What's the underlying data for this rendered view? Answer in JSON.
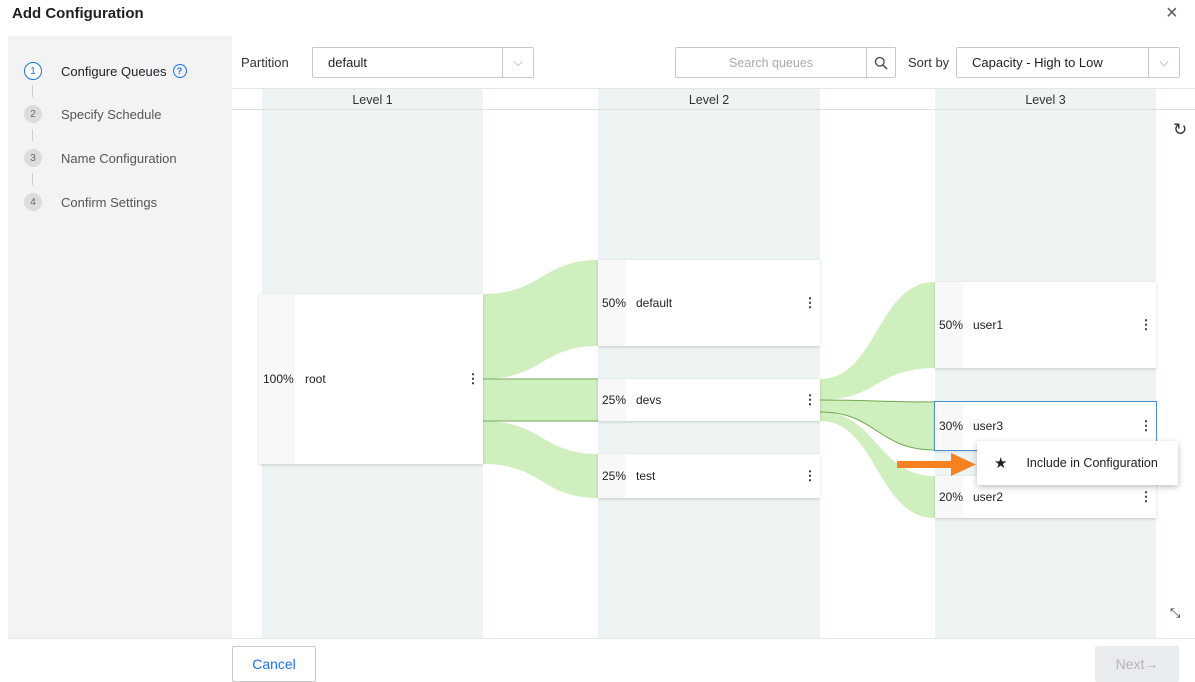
{
  "dialog": {
    "title": "Add Configuration",
    "close_icon": "×"
  },
  "steps": [
    {
      "num": "1",
      "label": "Configure Queues",
      "active": true
    },
    {
      "num": "2",
      "label": "Specify Schedule"
    },
    {
      "num": "3",
      "label": "Name Configuration"
    },
    {
      "num": "4",
      "label": "Confirm Settings"
    }
  ],
  "help_icon": "?",
  "toolbar": {
    "partition_label": "Partition",
    "partition_value": "default",
    "search_placeholder": "Search queues",
    "sort_label": "Sort by",
    "sort_value": "Capacity - High to Low",
    "caret": "⌵"
  },
  "levels": [
    "Level 1",
    "Level 2",
    "Level 3"
  ],
  "queues": {
    "root": {
      "pct": "100%",
      "name": "root"
    },
    "default": {
      "pct": "50%",
      "name": "default"
    },
    "devs": {
      "pct": "25%",
      "name": "devs"
    },
    "test": {
      "pct": "25%",
      "name": "test"
    },
    "user1": {
      "pct": "50%",
      "name": "user1"
    },
    "user3": {
      "pct": "30%",
      "name": "user3"
    },
    "user2": {
      "pct": "20%",
      "name": "user2"
    }
  },
  "kebab": "⋮",
  "context_menu": {
    "star": "★",
    "label": "Include in Configuration"
  },
  "footer": {
    "cancel": "Cancel",
    "next": "Next→"
  },
  "icons": {
    "refresh": "↻",
    "expand": "⤡"
  },
  "colors": {
    "accent": "#1a73e8",
    "flow": "#c8ecb4",
    "arrow": "#f5821f"
  }
}
